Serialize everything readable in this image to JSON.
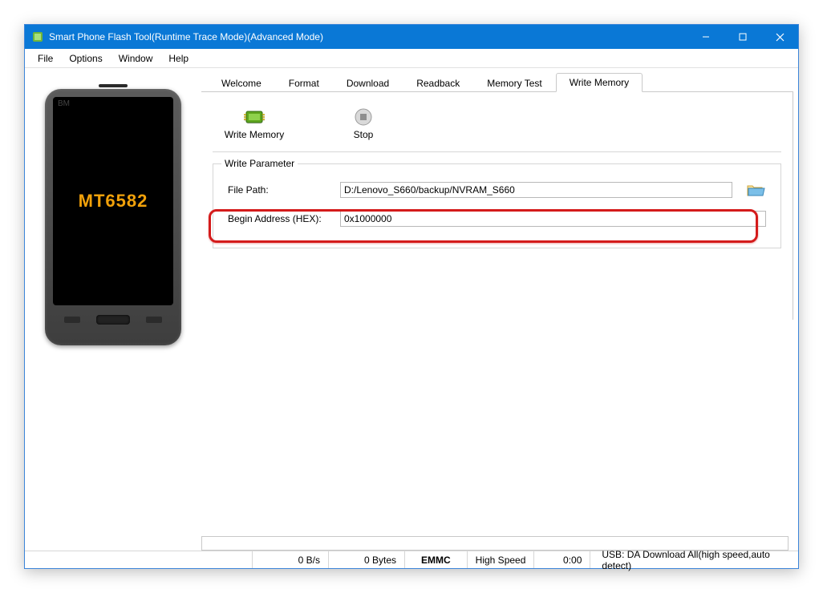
{
  "titlebar": {
    "title": "Smart Phone Flash Tool(Runtime Trace Mode)(Advanced Mode)"
  },
  "menu": {
    "file": "File",
    "options": "Options",
    "window": "Window",
    "help": "Help"
  },
  "phone": {
    "bm": "BM",
    "chip": "MT6582"
  },
  "tabs": {
    "welcome": "Welcome",
    "format": "Format",
    "download": "Download",
    "readback": "Readback",
    "memory_test": "Memory Test",
    "write_memory": "Write Memory"
  },
  "toolbar": {
    "write_memory": "Write Memory",
    "stop": "Stop"
  },
  "group": {
    "legend": "Write Parameter",
    "file_path_label": "File Path:",
    "file_path_value": "D:/Lenovo_S660/backup/NVRAM_S660",
    "begin_addr_label": "Begin Address (HEX):",
    "begin_addr_value": "0x1000000"
  },
  "status": {
    "rate": "0 B/s",
    "bytes": "0 Bytes",
    "storage": "EMMC",
    "speed": "High Speed",
    "time": "0:00",
    "usb": "USB: DA Download All(high speed,auto detect)"
  }
}
